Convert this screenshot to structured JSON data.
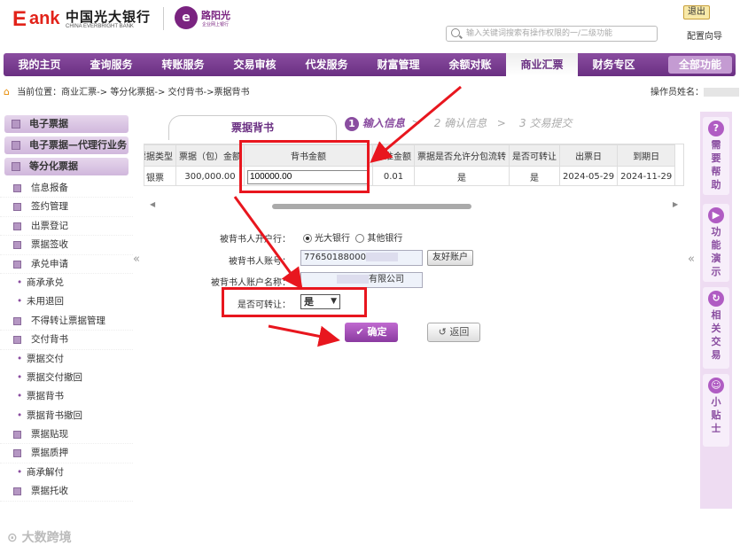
{
  "header": {
    "logo_e": "E",
    "logo_ank": "ank",
    "logo_cn": "中国光大银行",
    "logo_en": "CHINA EVERBRIGHT BANK",
    "sub_logo_title": "路阳光",
    "sub_logo_sub": "企业网上银行",
    "exit_label": "退出",
    "search_placeholder": "输入关键词搜索有操作权限的一/二级功能",
    "config_label": "配置向导"
  },
  "nav": {
    "items": [
      "我的主页",
      "查询服务",
      "转账服务",
      "交易审核",
      "代发服务",
      "财富管理",
      "余额对账",
      "商业汇票",
      "财务专区"
    ],
    "active": "商业汇票",
    "all_label": "全部功能"
  },
  "breadcrumb": {
    "text": "当前位置：商业汇票-> 等分化票据-> 交付背书->票据背书",
    "operator_label": "操作员姓名："
  },
  "sidebar": {
    "groups": [
      "电子票据",
      "电子票据—代理行业务",
      "等分化票据"
    ],
    "items": [
      {
        "label": "信息报备",
        "type": "item"
      },
      {
        "label": "签约管理",
        "type": "item"
      },
      {
        "label": "出票登记",
        "type": "item"
      },
      {
        "label": "票据签收",
        "type": "item"
      },
      {
        "label": "承兑申请",
        "type": "item"
      },
      {
        "label": "商承承兑",
        "type": "sub"
      },
      {
        "label": "未用退回",
        "type": "sub"
      },
      {
        "label": "不得转让票据管理",
        "type": "item"
      },
      {
        "label": "交付背书",
        "type": "item"
      },
      {
        "label": "票据交付",
        "type": "sub"
      },
      {
        "label": "票据交付撤回",
        "type": "sub"
      },
      {
        "label": "票据背书",
        "type": "sub"
      },
      {
        "label": "票据背书撤回",
        "type": "sub"
      },
      {
        "label": "票据贴现",
        "type": "item"
      },
      {
        "label": "票据质押",
        "type": "item"
      },
      {
        "label": "商承解付",
        "type": "sub"
      },
      {
        "label": "票据托收",
        "type": "item"
      }
    ]
  },
  "tab": {
    "label": "票据背书"
  },
  "steps": [
    {
      "num": "1",
      "label": "输入信息"
    },
    {
      "num": "2",
      "label": "确认信息"
    },
    {
      "num": "3",
      "label": "交易提交"
    }
  ],
  "table": {
    "headers": [
      "票据类型",
      "票据（包）金额",
      "背书金额",
      "标准金额",
      "票据是否允许分包流转",
      "是否可转让",
      "出票日",
      "到期日"
    ],
    "row": [
      "银票",
      "300,000.00",
      "100000.00",
      "0.01",
      "是",
      "是",
      "2024-05-29",
      "2024-11-29"
    ]
  },
  "form": {
    "bank_label": "被背书人开户行：",
    "bank_opt1": "光大银行",
    "bank_opt2": "其他银行",
    "acct_label": "被背书人账号：",
    "acct_value": "77650188000",
    "friend_btn": "友好账户",
    "name_label": "被背书人账户名称：",
    "name_value": "有限公司",
    "transfer_label": "是否可转让：",
    "transfer_value": "是",
    "ok_label": "确定",
    "back_label": "返回"
  },
  "right_panel": [
    {
      "icon": "?",
      "label": "需要帮助"
    },
    {
      "icon": "▶",
      "label": "功能演示"
    },
    {
      "icon": "↻",
      "label": "相关交易"
    },
    {
      "icon": "☺",
      "label": "小贴士"
    }
  ],
  "watermark": "大数跨境",
  "colors": {
    "brand_purple": "#6a2f82",
    "brand_red": "#e2231a",
    "annotation_red": "#e8161e"
  }
}
